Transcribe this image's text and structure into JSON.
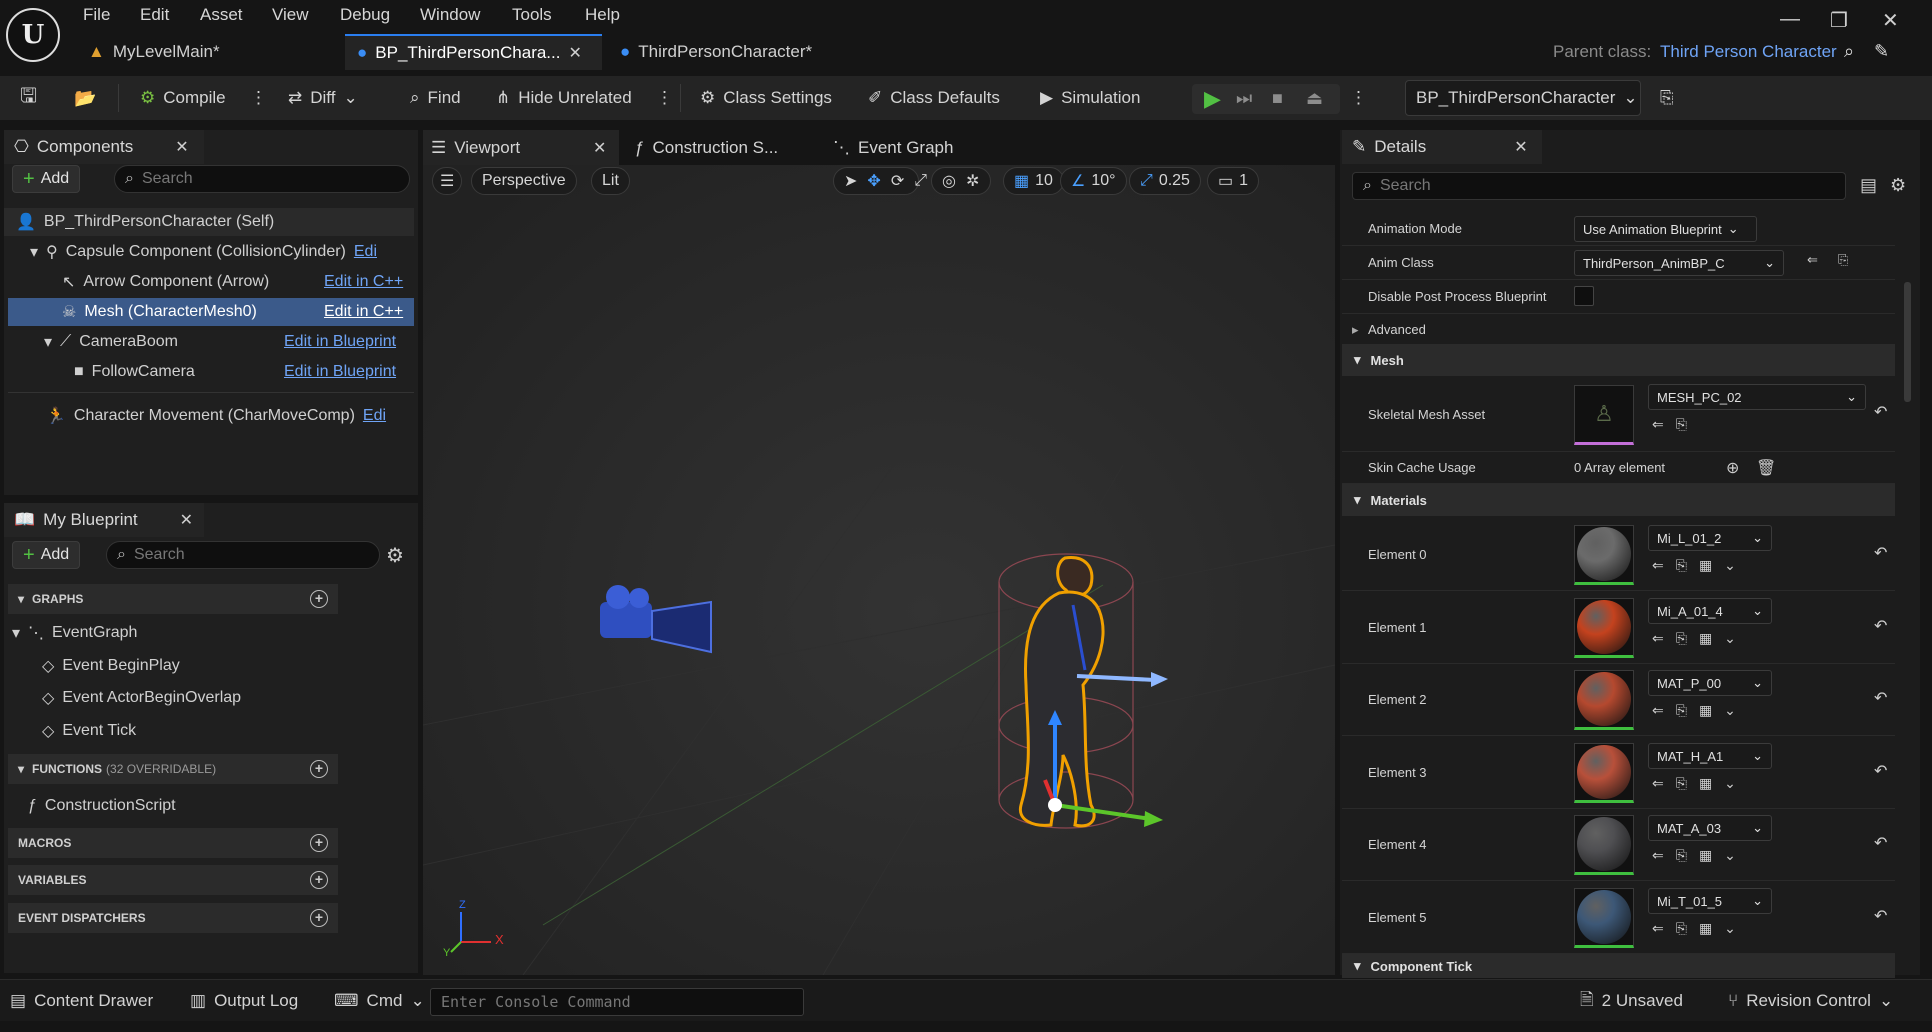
{
  "menu": [
    "File",
    "Edit",
    "Asset",
    "View",
    "Debug",
    "Window",
    "Tools",
    "Help"
  ],
  "tabs": [
    {
      "label": "MyLevelMain*"
    },
    {
      "label": "BP_ThirdPersonChara..."
    },
    {
      "label": "ThirdPersonCharacter*"
    }
  ],
  "parent_class": {
    "label": "Parent class:",
    "value": "Third Person Character"
  },
  "toolbar": {
    "compile": "Compile",
    "diff": "Diff",
    "find": "Find",
    "hide_unrelated": "Hide Unrelated",
    "class_settings": "Class Settings",
    "class_defaults": "Class Defaults",
    "simulation": "Simulation",
    "blueprint_selector": "BP_ThirdPersonCharacter"
  },
  "components": {
    "title": "Components",
    "add": "Add",
    "search_placeholder": "Search",
    "items": [
      {
        "label": "BP_ThirdPersonCharacter (Self)",
        "link": ""
      },
      {
        "label": "Capsule Component (CollisionCylinder)",
        "link": "Edi"
      },
      {
        "label": "Arrow Component (Arrow)",
        "link": "Edit in C++"
      },
      {
        "label": "Mesh (CharacterMesh0)",
        "link": "Edit in C++"
      },
      {
        "label": "CameraBoom",
        "link": "Edit in Blueprint"
      },
      {
        "label": "FollowCamera",
        "link": "Edit in Blueprint"
      },
      {
        "label": "Character Movement (CharMoveComp)",
        "link": "Edi"
      }
    ]
  },
  "my_blueprint": {
    "title": "My Blueprint",
    "add": "Add",
    "search_placeholder": "Search",
    "graphs": "GRAPHS",
    "event_graph": "EventGraph",
    "events": [
      "Event BeginPlay",
      "Event ActorBeginOverlap",
      "Event Tick"
    ],
    "functions": "FUNCTIONS",
    "functions_note": "(32 OVERRIDABLE)",
    "construction_script": "ConstructionScript",
    "macros": "MACROS",
    "variables": "VARIABLES",
    "dispatchers": "EVENT DISPATCHERS"
  },
  "viewport_tabs": [
    "Viewport",
    "Construction S...",
    "Event Graph"
  ],
  "viewport": {
    "perspective": "Perspective",
    "lit": "Lit",
    "grid": "10",
    "angle": "10°",
    "scale": "0.25",
    "camera_speed": "1",
    "axis_x": "X",
    "axis_y": "Y",
    "axis_z": "Z"
  },
  "details": {
    "title": "Details",
    "search_placeholder": "Search",
    "animation_mode_label": "Animation Mode",
    "animation_mode": "Use Animation Blueprint",
    "anim_class_label": "Anim Class",
    "anim_class": "ThirdPerson_AnimBP_C",
    "disable_pp_label": "Disable Post Process Blueprint",
    "advanced": "Advanced",
    "mesh_section": "Mesh",
    "skeletal_mesh_label": "Skeletal Mesh Asset",
    "skeletal_mesh": "MESH_PC_02",
    "skin_cache_label": "Skin Cache Usage",
    "skin_cache": "0 Array element",
    "materials_section": "Materials",
    "materials": [
      {
        "label": "Element 0",
        "value": "Mi_L_01_2",
        "color": "#6b6b6b"
      },
      {
        "label": "Element 1",
        "value": "Mi_A_01_4",
        "color": "#c4421e"
      },
      {
        "label": "Element 2",
        "value": "MAT_P_00",
        "color": "#b5492f"
      },
      {
        "label": "Element 3",
        "value": "MAT_H_A1",
        "color": "#b8503a"
      },
      {
        "label": "Element 4",
        "value": "MAT_A_03",
        "color": "#4f4f52"
      },
      {
        "label": "Element 5",
        "value": "Mi_T_01_5",
        "color": "#3d5877"
      }
    ],
    "component_tick": "Component Tick"
  },
  "status": {
    "content_drawer": "Content Drawer",
    "output_log": "Output Log",
    "cmd": "Cmd",
    "console_placeholder": "Enter Console Command",
    "unsaved": "2 Unsaved",
    "revision_control": "Revision Control"
  }
}
